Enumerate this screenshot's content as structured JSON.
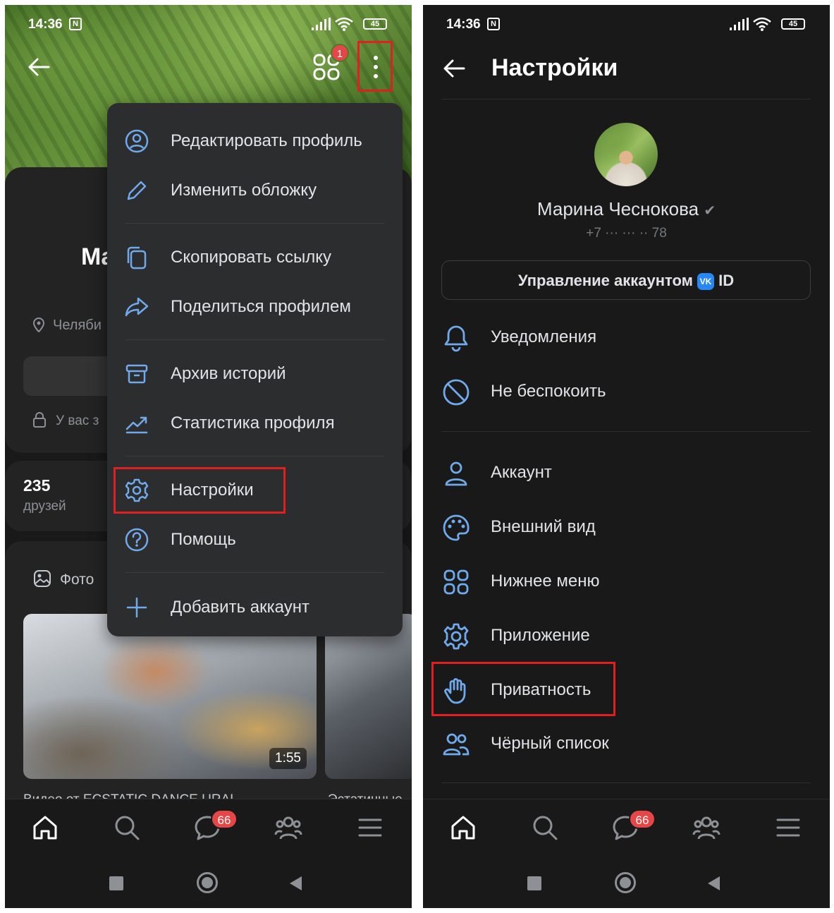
{
  "status": {
    "time": "14:36",
    "battery": "45"
  },
  "left": {
    "apps_badge": "1",
    "profile": {
      "name_partial": "Ma",
      "city_partial": "Челяби",
      "lock_partial": "У вас з",
      "friends_count": "235",
      "friends_label": "друзей",
      "photo_label": "Фото",
      "video_duration": "1:55",
      "video_caption_partial": "Видео от ECSTATIC DANCE URAL",
      "video2_caption_partial": "Эстатичные"
    },
    "menu": [
      {
        "label": "Редактировать профиль",
        "icon": "user-circle-icon"
      },
      {
        "label": "Изменить обложку",
        "icon": "pencil-icon"
      },
      {
        "label": "Скопировать ссылку",
        "icon": "copy-icon"
      },
      {
        "label": "Поделиться профилем",
        "icon": "share-icon"
      },
      {
        "label": "Архив историй",
        "icon": "archive-icon"
      },
      {
        "label": "Статистика профиля",
        "icon": "chart-icon"
      },
      {
        "label": "Настройки",
        "icon": "gear-icon"
      },
      {
        "label": "Помощь",
        "icon": "help-icon"
      },
      {
        "label": "Добавить аккаунт",
        "icon": "plus-icon"
      }
    ]
  },
  "right": {
    "title": "Настройки",
    "user_name": "Марина Чеснокова",
    "phone": "+7 ··· ··· ·· 78",
    "account_button": "Управление аккаунтом",
    "vk_id": "ID",
    "vk_logo": "VK",
    "items_group1": [
      {
        "label": "Уведомления",
        "icon": "bell-icon"
      },
      {
        "label": "Не беспокоить",
        "icon": "do-not-disturb-icon"
      }
    ],
    "items_group2": [
      {
        "label": "Аккаунт",
        "icon": "person-icon"
      },
      {
        "label": "Внешний вид",
        "icon": "palette-icon"
      },
      {
        "label": "Нижнее меню",
        "icon": "grid-icon"
      },
      {
        "label": "Приложение",
        "icon": "gear-icon"
      },
      {
        "label": "Приватность",
        "icon": "hand-icon"
      },
      {
        "label": "Чёрный список",
        "icon": "users-icon"
      }
    ]
  },
  "nav": {
    "messages_badge": "66"
  },
  "colors": {
    "accent": "#71aaeb",
    "highlight": "#e02020",
    "badge": "#e64646",
    "bg": "#19191a"
  }
}
